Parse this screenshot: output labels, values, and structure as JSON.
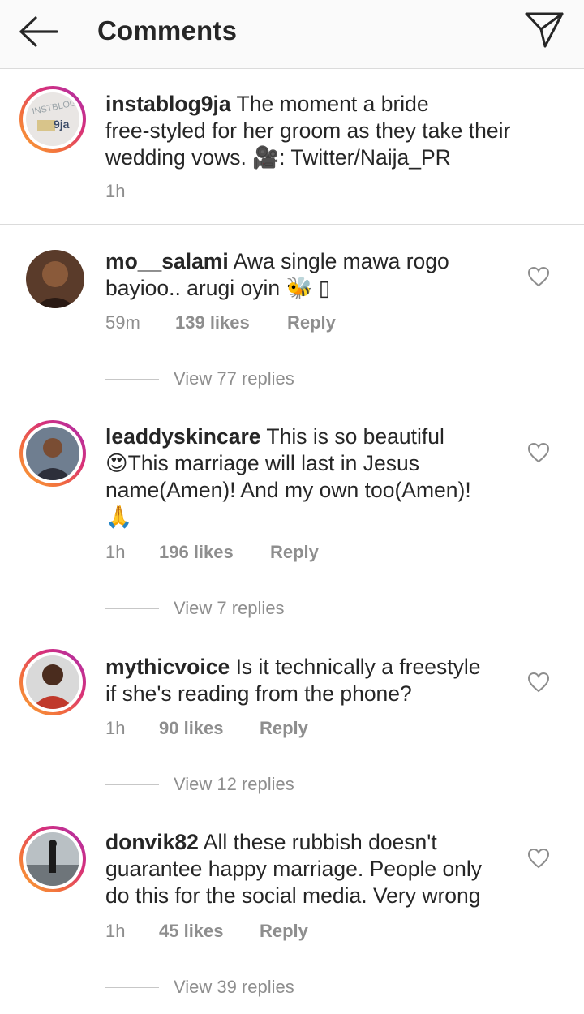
{
  "header": {
    "title": "Comments",
    "back_icon": "arrow-left-icon",
    "send_icon": "paper-plane-icon"
  },
  "caption": {
    "username": "instablog9ja",
    "lines": [
      "The moment a bride",
      "free-styled for her groom as they take their",
      "wedding vows. 🎥: Twitter/Naija_PR"
    ],
    "time": "1h",
    "avatar_text": "instablog9ja"
  },
  "comments": [
    {
      "username": "mo__salami",
      "lines": [
        "Awa single mawa rogo",
        "bayioo.. arugi oyin 🐝 ▯"
      ],
      "time": "59m",
      "likes": "139 likes",
      "reply": "Reply",
      "view_replies": "View 77 replies"
    },
    {
      "username": "leaddyskincare",
      "lines": [
        "This is so beautiful",
        "😍This marriage will last in Jesus",
        "name(Amen)! And my own too(Amen)!",
        "🙏"
      ],
      "time": "1h",
      "likes": "196 likes",
      "reply": "Reply",
      "view_replies": "View 7 replies"
    },
    {
      "username": "mythicvoice",
      "lines": [
        "Is it technically a freestyle",
        "if she's reading from the phone?"
      ],
      "time": "1h",
      "likes": "90 likes",
      "reply": "Reply",
      "view_replies": "View 12 replies"
    },
    {
      "username": "donvik82",
      "lines": [
        "All these rubbish doesn't",
        "guarantee happy marriage. People only",
        "do this for the social media. Very wrong"
      ],
      "time": "1h",
      "likes": "45 likes",
      "reply": "Reply",
      "view_replies": "View 39 replies"
    }
  ],
  "colors": {
    "text": "#262626",
    "muted": "#8e8e8e",
    "divider": "#dbdbdb",
    "story_ring_start": "#f9a636",
    "story_ring_end": "#a62fb0"
  }
}
